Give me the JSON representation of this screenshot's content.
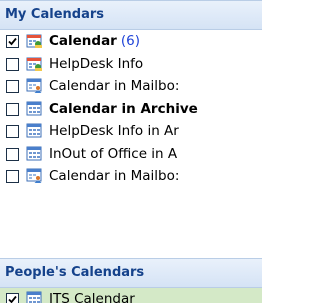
{
  "my_calendars": {
    "header": "My Calendars",
    "items": [
      {
        "label": "Calendar",
        "count": "(6)",
        "checked": true,
        "bold": true,
        "icon": "calendar-shared-icon"
      },
      {
        "label": "HelpDesk Info",
        "count": "",
        "checked": false,
        "bold": false,
        "icon": "calendar-shared-icon"
      },
      {
        "label": "Calendar in Mailbo:",
        "count": "",
        "checked": false,
        "bold": false,
        "icon": "calendar-mailbox-icon"
      },
      {
        "label": "Calendar in Archive",
        "count": "",
        "checked": false,
        "bold": true,
        "icon": "calendar-grid-icon"
      },
      {
        "label": "HelpDesk Info in Ar",
        "count": "",
        "checked": false,
        "bold": false,
        "icon": "calendar-grid-icon"
      },
      {
        "label": "InOut of Office in A",
        "count": "",
        "checked": false,
        "bold": false,
        "icon": "calendar-grid-icon"
      },
      {
        "label": "Calendar in Mailbo:",
        "count": "",
        "checked": false,
        "bold": false,
        "icon": "calendar-mailbox-icon"
      }
    ]
  },
  "peoples_calendars": {
    "header": "People's Calendars",
    "items": [
      {
        "label": "ITS Calendar",
        "count": "",
        "checked": true,
        "bold": false,
        "icon": "calendar-grid-icon"
      }
    ]
  },
  "colors": {
    "header_text": "#15428b",
    "count_text": "#1f43d8",
    "selected_row": "#d4e9c7"
  }
}
